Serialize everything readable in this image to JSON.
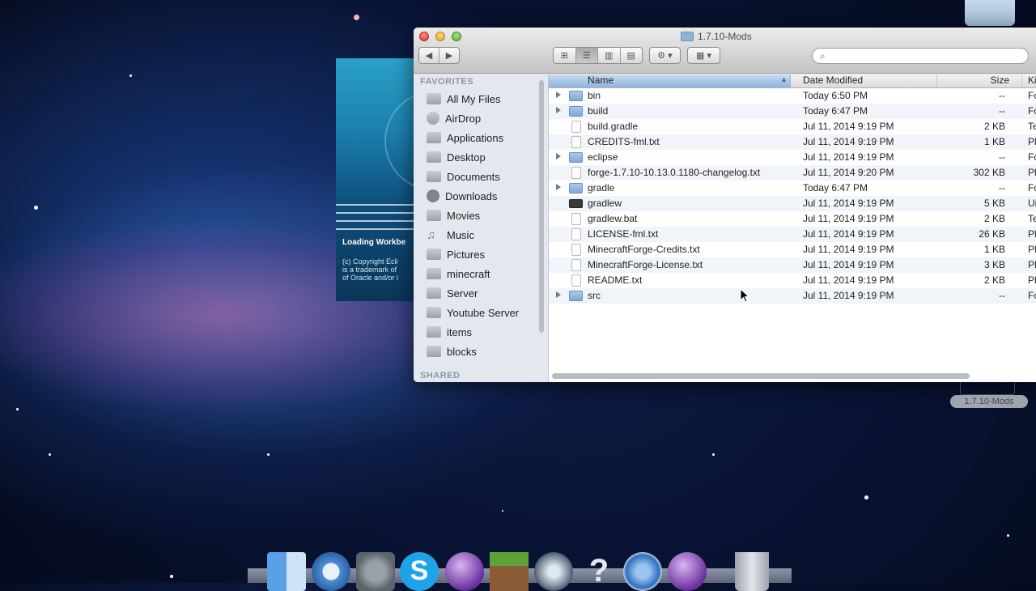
{
  "window": {
    "title": "1.7.10-Mods",
    "search_placeholder": ""
  },
  "splash": {
    "loading_text": "Loading Workbe",
    "copyright_lines": [
      "(c) Copyright Ecli",
      "is a trademark of",
      "of Oracle and/or i"
    ]
  },
  "sidebar": {
    "favorites_heading": "FAVORITES",
    "shared_heading": "SHARED",
    "items": [
      {
        "label": "All My Files",
        "icon": "all-files-icon"
      },
      {
        "label": "AirDrop",
        "icon": "airdrop-icon"
      },
      {
        "label": "Applications",
        "icon": "applications-icon"
      },
      {
        "label": "Desktop",
        "icon": "desktop-icon"
      },
      {
        "label": "Documents",
        "icon": "documents-icon"
      },
      {
        "label": "Downloads",
        "icon": "downloads-icon"
      },
      {
        "label": "Movies",
        "icon": "movies-icon"
      },
      {
        "label": "Music",
        "icon": "music-icon"
      },
      {
        "label": "Pictures",
        "icon": "pictures-icon"
      },
      {
        "label": "minecraft",
        "icon": "folder-icon"
      },
      {
        "label": "Server",
        "icon": "folder-icon"
      },
      {
        "label": "Youtube Server",
        "icon": "folder-icon"
      },
      {
        "label": "items",
        "icon": "folder-icon"
      },
      {
        "label": "blocks",
        "icon": "folder-icon"
      }
    ]
  },
  "columns": {
    "name": "Name",
    "date": "Date Modified",
    "size": "Size",
    "kind": "Ki"
  },
  "files": [
    {
      "name": "bin",
      "date": "Today 6:50 PM",
      "size": "--",
      "kind": "Fo",
      "type": "folder"
    },
    {
      "name": "build",
      "date": "Today 6:47 PM",
      "size": "--",
      "kind": "Fo",
      "type": "folder"
    },
    {
      "name": "build.gradle",
      "date": "Jul 11, 2014 9:19 PM",
      "size": "2 KB",
      "kind": "Te",
      "type": "file"
    },
    {
      "name": "CREDITS-fml.txt",
      "date": "Jul 11, 2014 9:19 PM",
      "size": "1 KB",
      "kind": "Pl",
      "type": "file"
    },
    {
      "name": "eclipse",
      "date": "Jul 11, 2014 9:19 PM",
      "size": "--",
      "kind": "Fo",
      "type": "folder"
    },
    {
      "name": "forge-1.7.10-10.13.0.1180-changelog.txt",
      "date": "Jul 11, 2014 9:20 PM",
      "size": "302 KB",
      "kind": "Pl",
      "type": "file"
    },
    {
      "name": "gradle",
      "date": "Today 6:47 PM",
      "size": "--",
      "kind": "Fo",
      "type": "folder"
    },
    {
      "name": "gradlew",
      "date": "Jul 11, 2014 9:19 PM",
      "size": "5 KB",
      "kind": "Ui",
      "type": "exec"
    },
    {
      "name": "gradlew.bat",
      "date": "Jul 11, 2014 9:19 PM",
      "size": "2 KB",
      "kind": "Te",
      "type": "file"
    },
    {
      "name": "LICENSE-fml.txt",
      "date": "Jul 11, 2014 9:19 PM",
      "size": "26 KB",
      "kind": "Pl",
      "type": "file"
    },
    {
      "name": "MinecraftForge-Credits.txt",
      "date": "Jul 11, 2014 9:19 PM",
      "size": "1 KB",
      "kind": "Pl",
      "type": "file"
    },
    {
      "name": "MinecraftForge-License.txt",
      "date": "Jul 11, 2014 9:19 PM",
      "size": "3 KB",
      "kind": "Pl",
      "type": "file"
    },
    {
      "name": "README.txt",
      "date": "Jul 11, 2014 9:19 PM",
      "size": "2 KB",
      "kind": "Pl",
      "type": "file"
    },
    {
      "name": "src",
      "date": "Jul 11, 2014 9:19 PM",
      "size": "--",
      "kind": "Fo",
      "type": "folder"
    }
  ],
  "desktop": {
    "drag_label": "1.7.10-Mods"
  },
  "dock": {
    "items": [
      "finder-icon",
      "safari-icon",
      "system-preferences-icon",
      "skype-icon",
      "eclipse-icon",
      "minecraft-icon",
      "quicktime-icon",
      "help-icon",
      "network-icon",
      "eclipse-icon-2",
      "trash-icon"
    ]
  }
}
